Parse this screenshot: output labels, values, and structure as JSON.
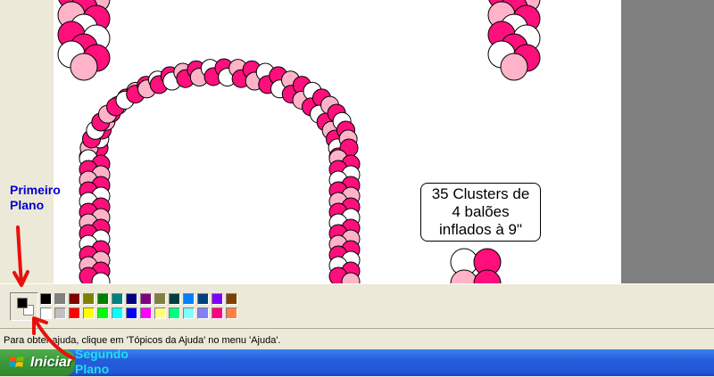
{
  "status_text": "Para obter ajuda, clique em 'Tópicos da Ajuda' no menu 'Ajuda'.",
  "start_button_label": "Iniciar",
  "annotations": {
    "primeiro_line1": "Primeiro",
    "primeiro_line2": "Plano",
    "segundo_line1": "Segundo",
    "segundo_line2": "Plano"
  },
  "callout": {
    "line1": "35 Clusters de",
    "line2": "4 balões",
    "line3": "inflados à 9\""
  },
  "current_colors": {
    "foreground": "#000000",
    "background": "#ffffff"
  },
  "palette_row1": [
    "#000000",
    "#808080",
    "#800000",
    "#808000",
    "#008000",
    "#008080",
    "#000080",
    "#800080",
    "#808040",
    "#004040",
    "#0080ff",
    "#004080",
    "#8000ff",
    "#804000"
  ],
  "palette_row2": [
    "#ffffff",
    "#c0c0c0",
    "#ff0000",
    "#ffff00",
    "#00ff00",
    "#00ffff",
    "#0000ff",
    "#ff00ff",
    "#ffff80",
    "#00ff80",
    "#80ffff",
    "#8080ff",
    "#ff0080",
    "#ff8040"
  ],
  "balloon_colors": {
    "magenta": "#ff0f7b",
    "pink": "#ffb3c8",
    "white": "#ffffff"
  },
  "annotation_arrow_color": "#e8100c"
}
